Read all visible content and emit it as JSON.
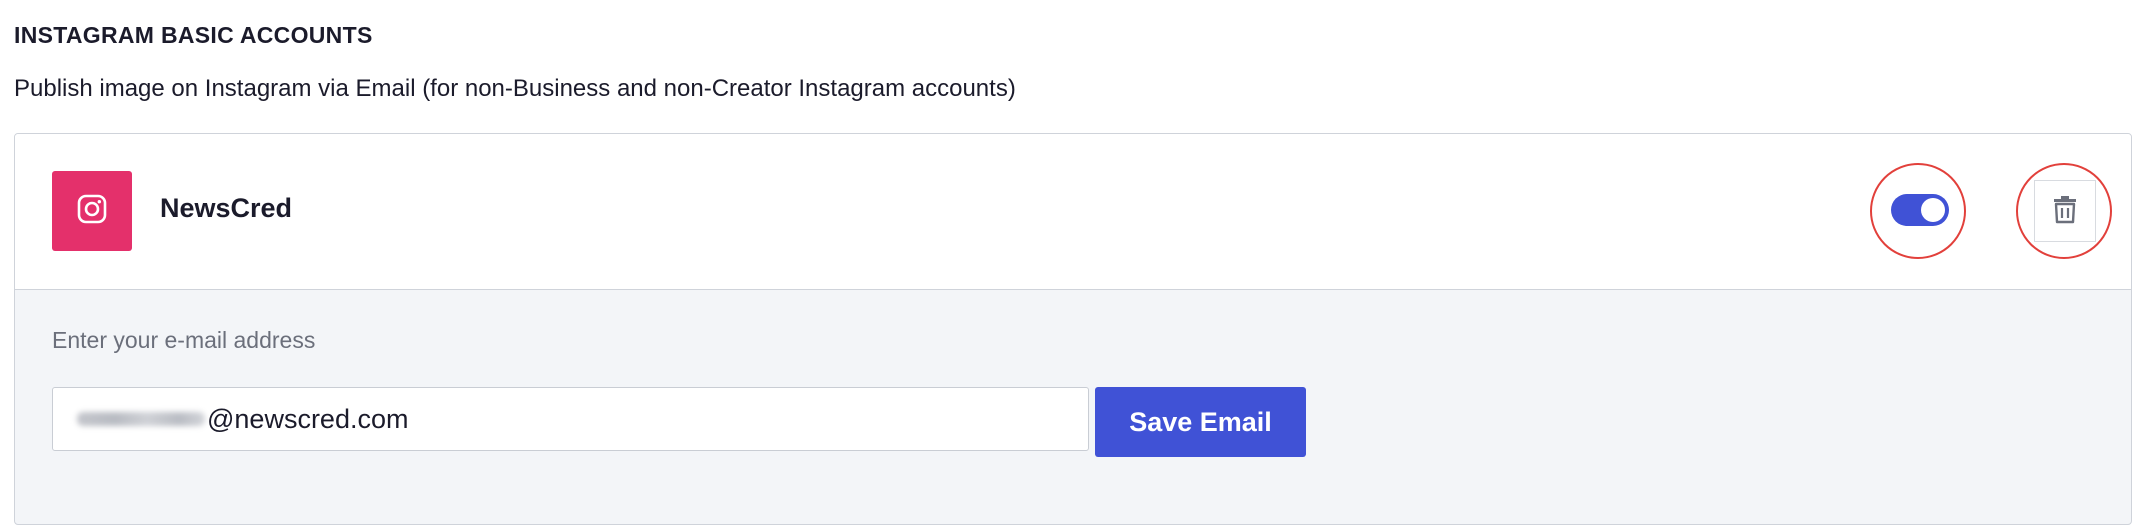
{
  "section": {
    "title": "INSTAGRAM BASIC ACCOUNTS",
    "description": "Publish image on Instagram via Email (for non-Business and non-Creator Instagram accounts)"
  },
  "account": {
    "name": "NewsCred",
    "icon": "instagram-icon",
    "brand_color": "#e4306b",
    "enabled": true
  },
  "email": {
    "label": "Enter your e-mail address",
    "value_visible_part": "@newscred.com",
    "local_part_blurred": true,
    "save_label": "Save Email"
  },
  "colors": {
    "accent": "#4052d6",
    "highlight_circle": "#e2403b"
  }
}
